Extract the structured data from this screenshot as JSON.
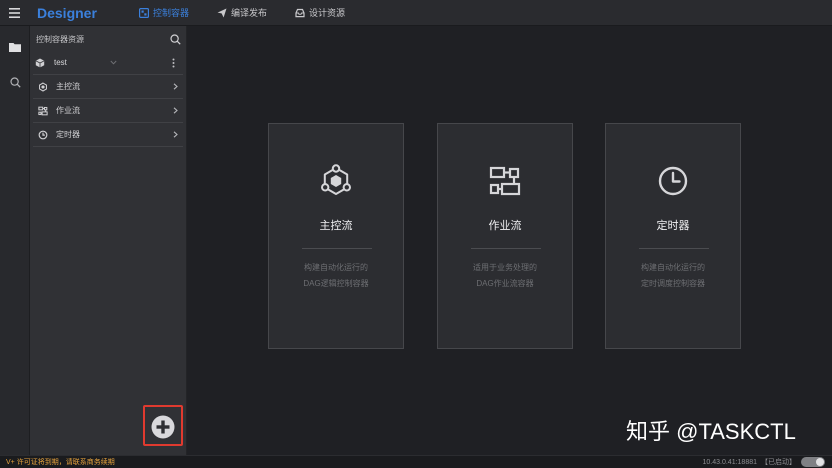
{
  "app": {
    "title": "Designer",
    "accent_color": "#3b80dc"
  },
  "header": {
    "menu_icon": "hamburger-menu-icon",
    "tabs": [
      {
        "label": "控制容器",
        "icon": "container-icon",
        "active": true
      },
      {
        "label": "编译发布",
        "icon": "send-icon",
        "active": false
      },
      {
        "label": "设计资源",
        "icon": "tray-icon",
        "active": false
      }
    ]
  },
  "rail": {
    "items": [
      {
        "icon": "folder-icon",
        "active": true
      },
      {
        "icon": "search-icon",
        "active": false
      }
    ]
  },
  "sidebar": {
    "title": "控制容器资源",
    "search_icon": "search-icon",
    "project": {
      "name": "test",
      "icon": "cube-icon"
    },
    "items": [
      {
        "label": "主控流",
        "icon": "hexagon-node-icon"
      },
      {
        "label": "作业流",
        "icon": "flow-icon"
      },
      {
        "label": "定时器",
        "icon": "clock-icon"
      }
    ],
    "add_button": {
      "icon": "plus-circle-icon",
      "highlight_color": "#e03a2f"
    }
  },
  "cards": [
    {
      "title": "主控流",
      "icon": "hexagon-node-icon",
      "description": [
        "构建自动化运行的",
        "DAG逻辑控制容器"
      ]
    },
    {
      "title": "作业流",
      "icon": "flow-icon",
      "description": [
        "适用于业务处理的",
        "DAG作业流容器"
      ]
    },
    {
      "title": "定时器",
      "icon": "clock-icon",
      "description": [
        "构建自动化运行的",
        "定时调度控制容器"
      ]
    }
  ],
  "watermark": "知乎 @TASKCTL",
  "status_bar": {
    "notice": "V+ 许可证将到期，请联系商务续期",
    "notice_color": "#e6a23c",
    "server": "10.43.0.41:18881",
    "server_state": "【已启动】",
    "toggle_on": true
  }
}
